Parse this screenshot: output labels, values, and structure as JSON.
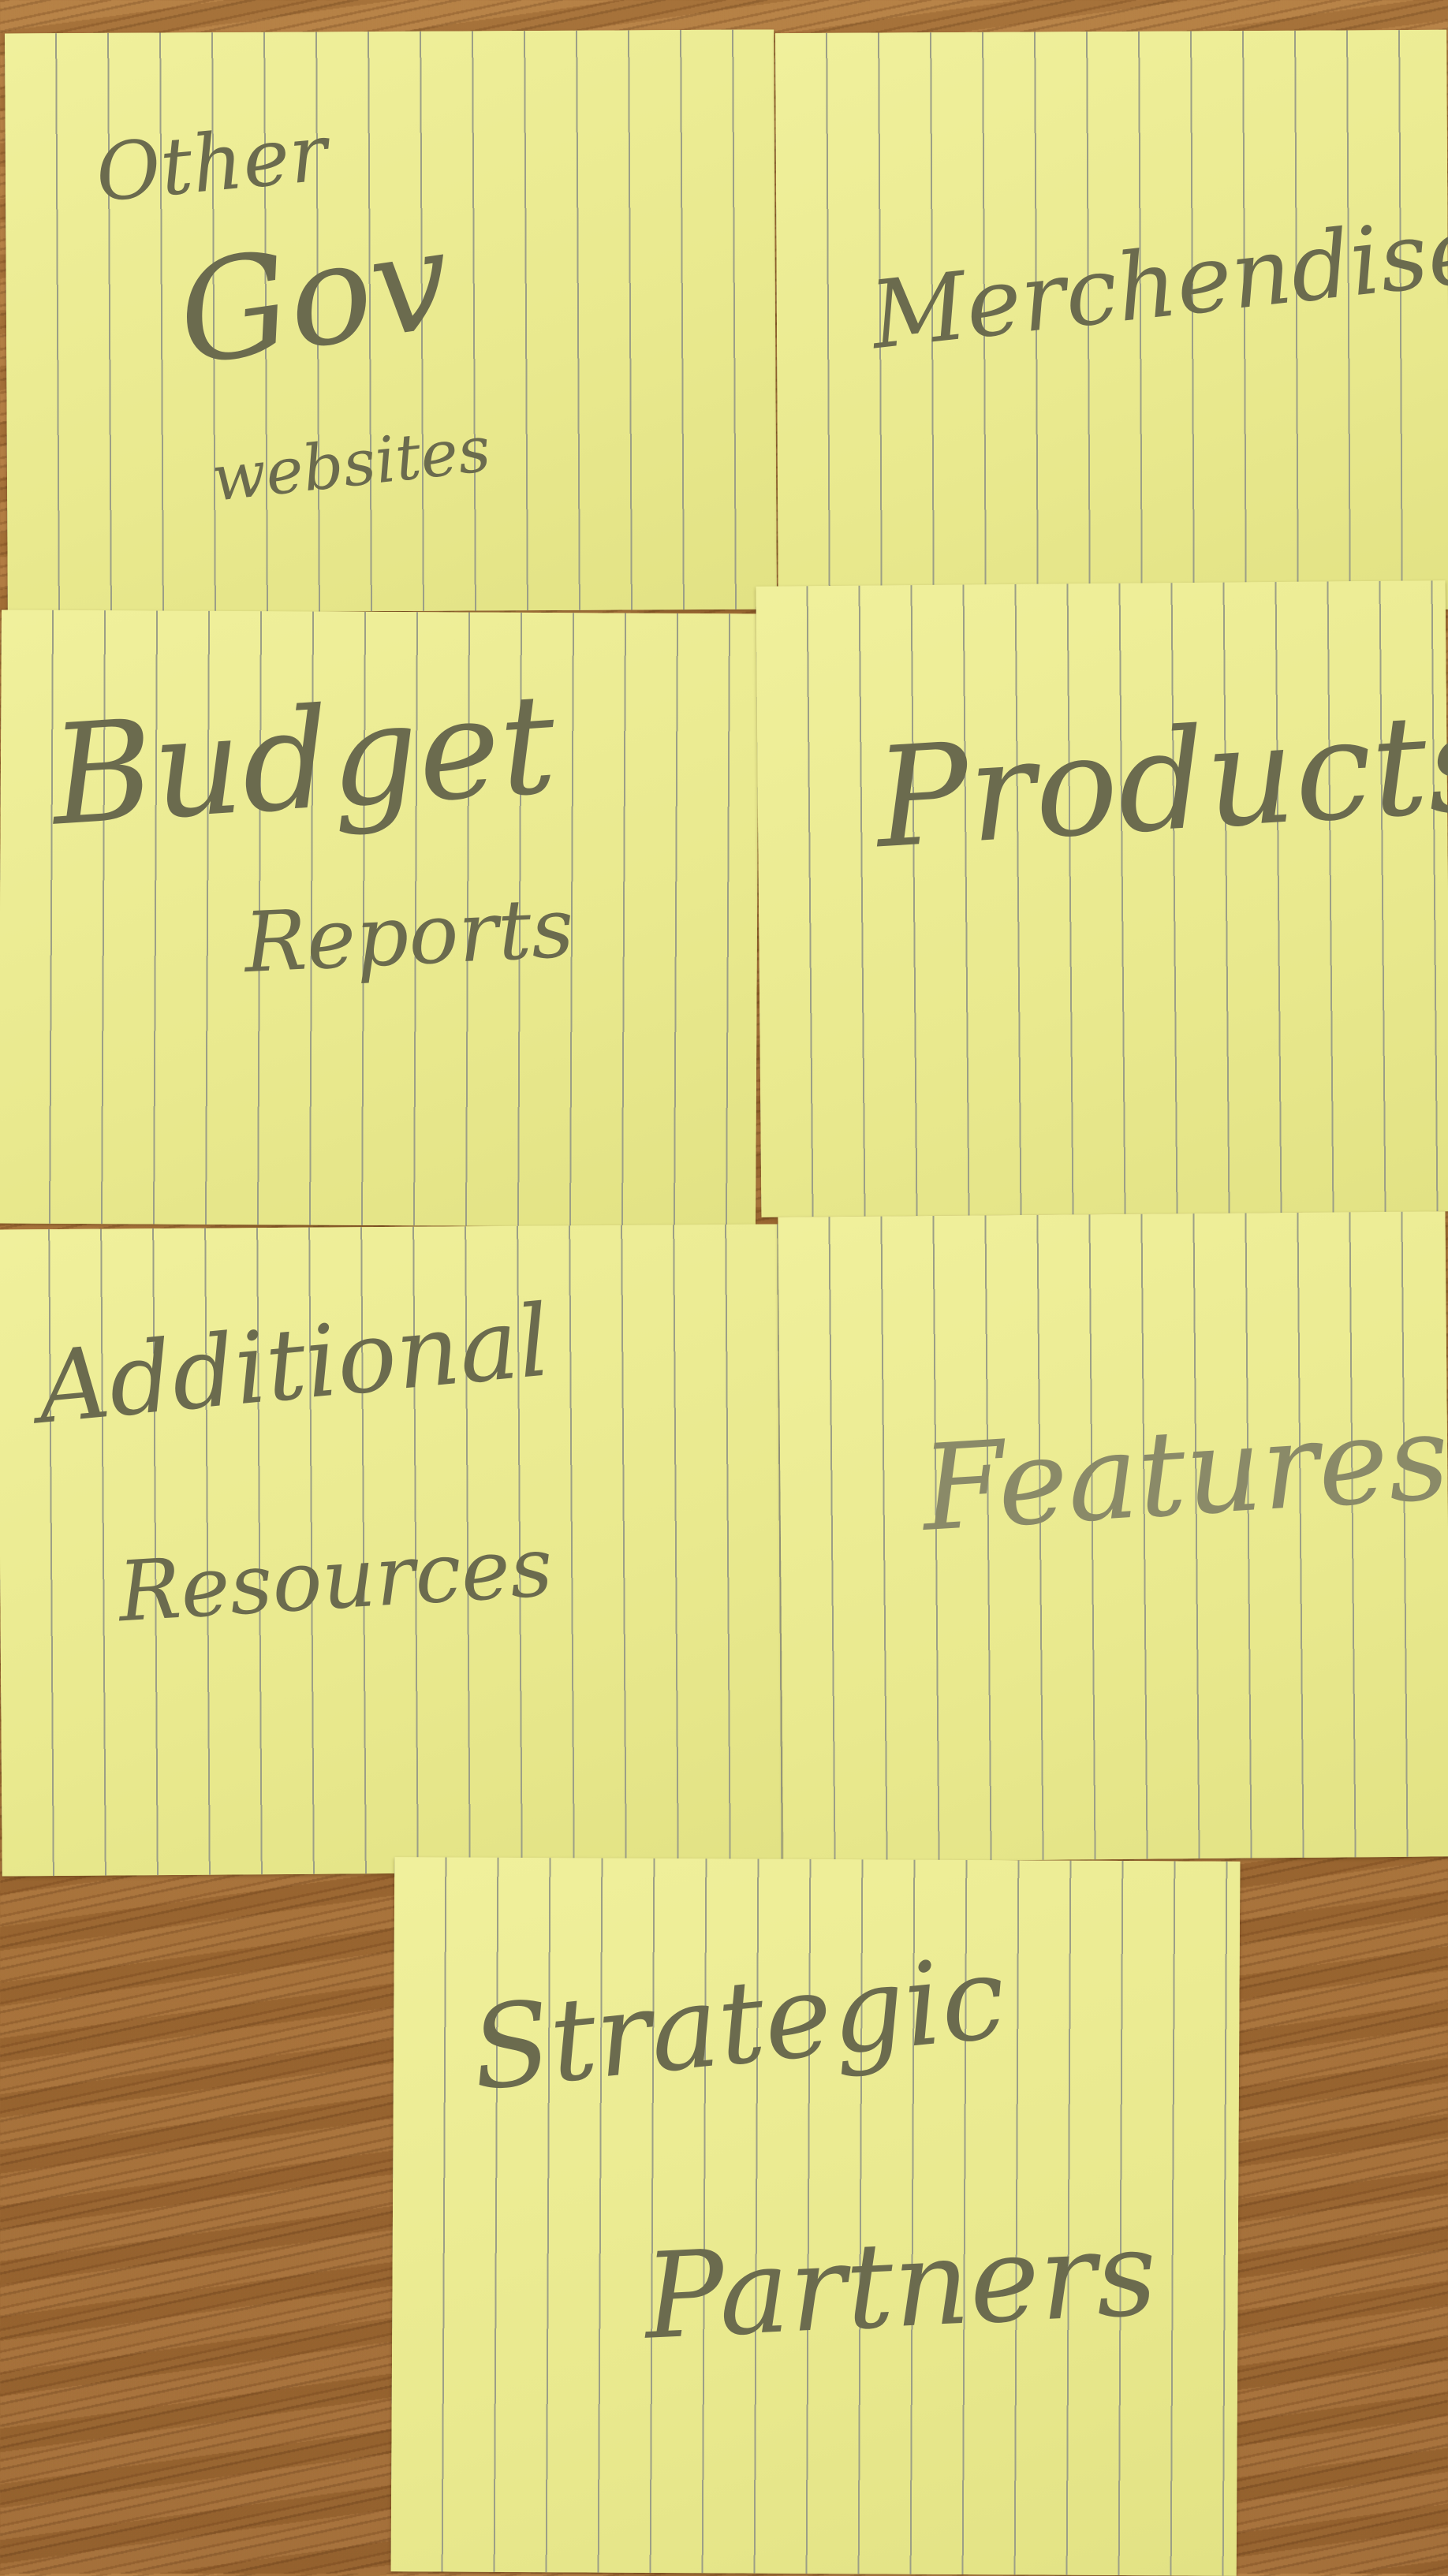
{
  "cards": [
    {
      "lines": [
        "Other",
        "Gov",
        "websites"
      ]
    },
    {
      "lines": [
        "Merchendise"
      ]
    },
    {
      "lines": [
        "Budget",
        "Reports"
      ]
    },
    {
      "lines": [
        "Products"
      ]
    },
    {
      "lines": [
        "Additional",
        "Resources"
      ]
    },
    {
      "lines": [
        "Features"
      ]
    },
    {
      "lines": [
        "Strategic",
        "Partners"
      ]
    }
  ]
}
